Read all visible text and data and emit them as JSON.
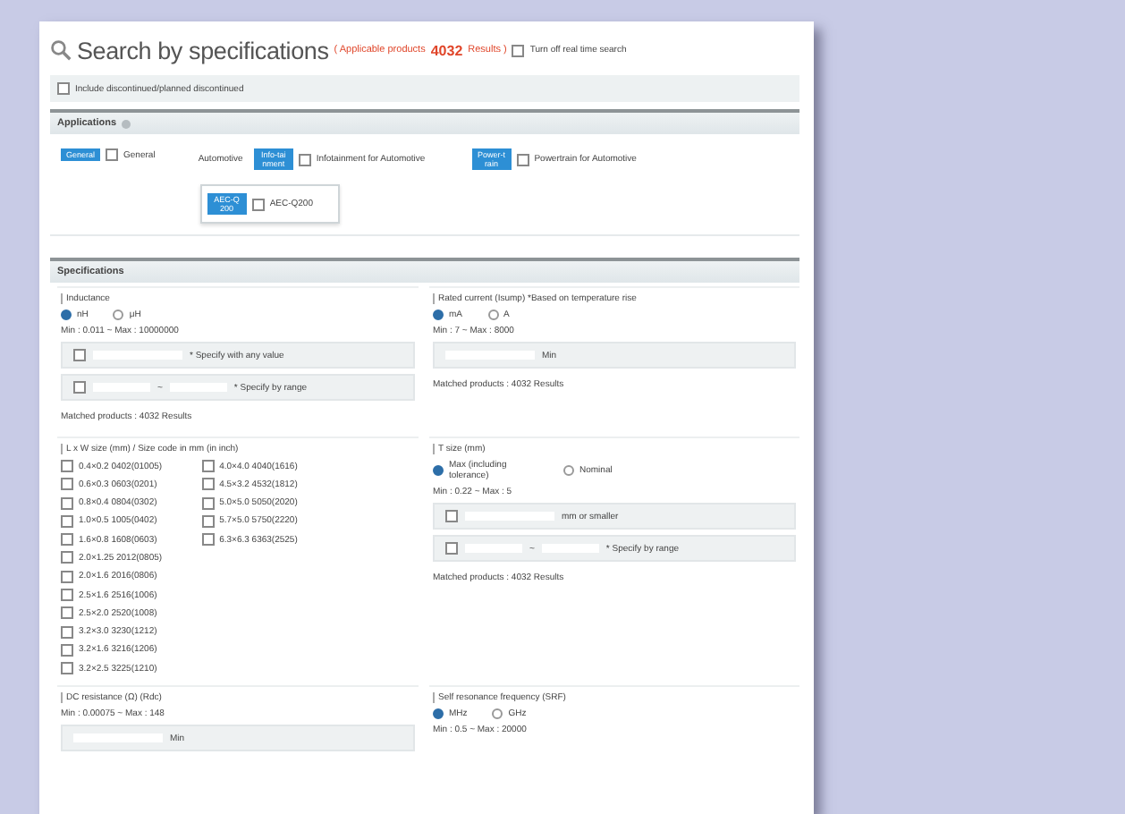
{
  "header": {
    "title": "Search by specifications",
    "results_prefix": "( Applicable products",
    "results_count": "4032",
    "results_suffix": "Results )",
    "realtime_option": {
      "label": "Turn off real time search",
      "checked": false
    }
  },
  "include_option": {
    "label": "Include discontinued/planned discontinued",
    "checked": false
  },
  "applications": {
    "title": "Applications",
    "options": [
      {
        "badge": "General",
        "label": "General",
        "checked": false
      }
    ],
    "automotive": {
      "label": "Automotive",
      "options": [
        {
          "badge": "Info-tainment",
          "label": "Infotainment for Automotive",
          "checked": false
        },
        {
          "badge": "Power-train",
          "label": "Powertrain for Automotive",
          "checked": false
        }
      ],
      "sub_option": {
        "badge": "AEC-Q200",
        "label": "AEC-Q200",
        "checked": false
      }
    }
  },
  "specifications": {
    "title": "Specifications",
    "filters": [
      {
        "kind": "value",
        "title": "Inductance",
        "units": [
          {
            "label": "nH",
            "selected": true
          },
          {
            "label": "μH",
            "selected": false
          }
        ],
        "range": "Min : 0.011 ~ Max : 10000000",
        "rows": [
          {
            "kind": "single",
            "checked": false,
            "suffix": "* Specify with any value"
          },
          {
            "kind": "range",
            "checked": false,
            "separator": "~",
            "suffix": "* Specify by range"
          }
        ],
        "matched": "Matched products : 4032 Results"
      },
      {
        "kind": "value",
        "title": "Rated current (Isump) *Based on temperature rise",
        "units": [
          {
            "label": "mA",
            "selected": true
          },
          {
            "label": "A",
            "selected": false
          }
        ],
        "range": "Min : 7 ~ Max : 8000",
        "rows": [
          {
            "kind": "single",
            "suffix": "Min"
          }
        ],
        "matched": "Matched products : 4032 Results"
      },
      {
        "kind": "checklist",
        "title": "L x W size (mm) / Size code in mm (in inch)",
        "columns": [
          [
            {
              "label": "0.4×0.2 0402(01005)",
              "checked": false
            },
            {
              "label": "0.6×0.3 0603(0201)",
              "checked": false
            },
            {
              "label": "0.8×0.4 0804(0302)",
              "checked": false
            },
            {
              "label": "1.0×0.5 1005(0402)",
              "checked": false
            },
            {
              "label": "1.6×0.8 1608(0603)",
              "checked": false
            },
            {
              "label": "2.0×1.25 2012(0805)",
              "checked": false
            },
            {
              "label": "2.0×1.6 2016(0806)",
              "checked": false
            },
            {
              "label": "2.5×1.6 2516(1006)",
              "checked": false
            },
            {
              "label": "2.5×2.0 2520(1008)",
              "checked": false
            },
            {
              "label": "3.2×3.0 3230(1212)",
              "checked": false
            },
            {
              "label": "3.2×1.6 3216(1206)",
              "checked": false
            },
            {
              "label": "3.2×2.5 3225(1210)",
              "checked": false
            }
          ],
          [
            {
              "label": "4.0×4.0 4040(1616)",
              "checked": false
            },
            {
              "label": "4.5×3.2 4532(1812)",
              "checked": false
            },
            {
              "label": "5.0×5.0 5050(2020)",
              "checked": false
            },
            {
              "label": "5.7×5.0 5750(2220)",
              "checked": false
            },
            {
              "label": "6.3×6.3 6363(2525)",
              "checked": false
            }
          ]
        ]
      },
      {
        "kind": "value",
        "title": "T size (mm)",
        "units": [
          {
            "label": "Max (including tolerance)",
            "selected": true
          },
          {
            "label": "Nominal",
            "selected": false
          }
        ],
        "range": "Min : 0.22 ~ Max : 5",
        "rows": [
          {
            "kind": "single",
            "checked": false,
            "suffix": "mm or smaller"
          },
          {
            "kind": "range",
            "checked": false,
            "separator": "~",
            "suffix": "* Specify by range"
          }
        ],
        "matched": "Matched products : 4032 Results"
      },
      {
        "kind": "value",
        "title": "DC resistance (Ω) (Rdc)",
        "range": "Min : 0.00075 ~ Max : 148",
        "rows": [
          {
            "kind": "single",
            "suffix": "Min"
          }
        ]
      },
      {
        "kind": "value",
        "title": "Self resonance frequency (SRF)",
        "units": [
          {
            "label": "MHz",
            "selected": true
          },
          {
            "label": "GHz",
            "selected": false
          }
        ],
        "range": "Min : 0.5 ~ Max : 20000"
      }
    ]
  }
}
